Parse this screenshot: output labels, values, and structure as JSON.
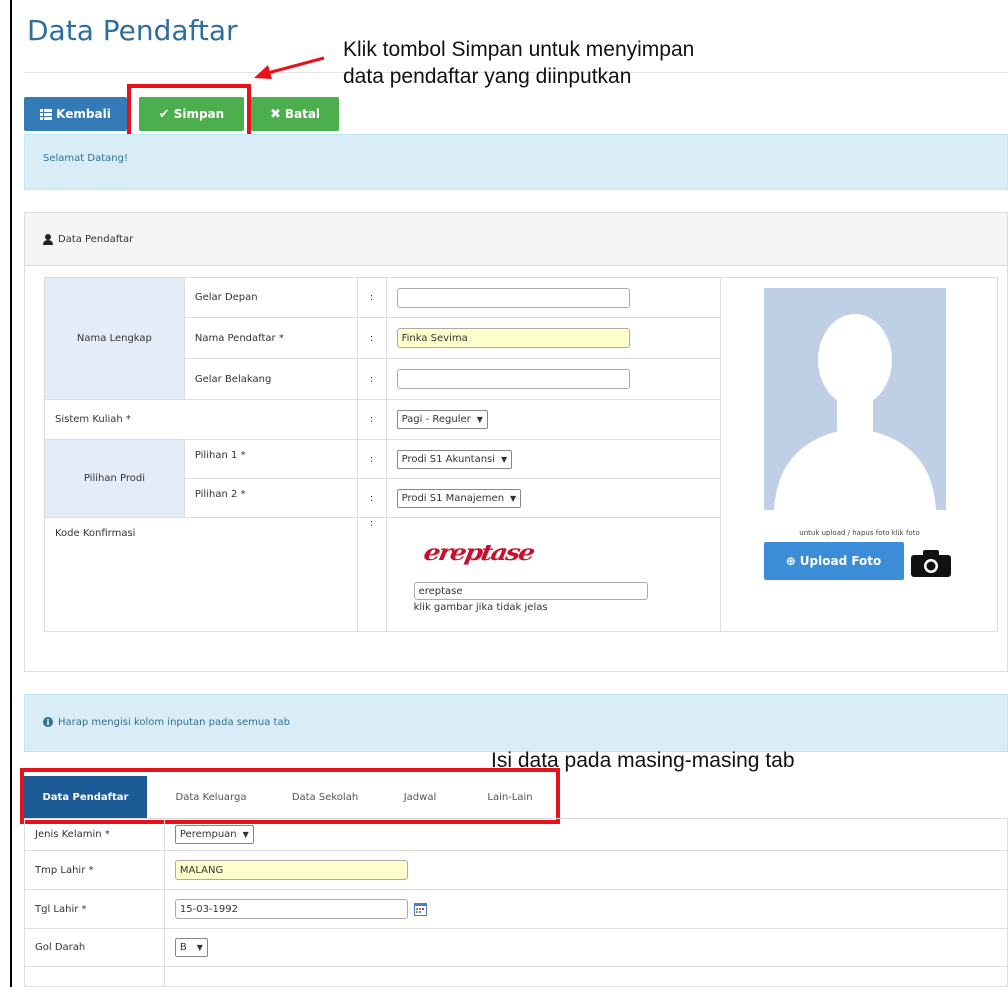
{
  "page": {
    "title": "Data Pendaftar"
  },
  "annotations": {
    "top_line1": "Klik tombol Simpan untuk menyimpan",
    "top_line2": "data pendaftar yang diinputkan",
    "tabs_note": "Isi data pada masing-masing tab"
  },
  "toolbar": {
    "back_label": "Kembali",
    "save_label": "Simpan",
    "cancel_label": "Batal"
  },
  "welcome": "Selamat Datang!",
  "panel": {
    "title": "Data Pendaftar"
  },
  "form": {
    "nama_lengkap_label": "Nama Lengkap",
    "gelar_depan_label": "Gelar Depan",
    "gelar_depan_value": "",
    "nama_pendaftar_label": "Nama Pendaftar *",
    "nama_pendaftar_value": "Finka Sevima",
    "gelar_belakang_label": "Gelar Belakang",
    "gelar_belakang_value": "",
    "sistem_kuliah_label": "Sistem Kuliah *",
    "sistem_kuliah_value": "Pagi - Reguler",
    "pilihan_prodi_label": "Pilihan Prodi",
    "pilihan1_label": "Pilihan 1 *",
    "pilihan1_value": "Prodi S1 Akuntansi",
    "pilihan2_label": "Pilihan 2 *",
    "pilihan2_value": "Prodi S1 Manajemen",
    "kode_label": "Kode Konfirmasi",
    "captcha_text": "ereptase",
    "captcha_input_value": "ereptase",
    "captcha_hint": "klik gambar jika tidak jelas",
    "colon": ":"
  },
  "photo": {
    "hint": "untuk upload / hapus foto klik foto",
    "upload_label": "Upload Foto"
  },
  "notice": "Harap mengisi kolom inputan pada semua tab",
  "tabs": [
    "Data Pendaftar",
    "Data Keluarga",
    "Data Sekolah",
    "Jadwal",
    "Lain-Lain"
  ],
  "bottom_form": {
    "jenis_kelamin_label": "Jenis Kelamin *",
    "jenis_kelamin_value": "Perempuan",
    "tmp_lahir_label": "Tmp Lahir *",
    "tmp_lahir_value": "MALANG",
    "tgl_lahir_label": "Tgl Lahir *",
    "tgl_lahir_value": "15-03-1992",
    "gol_darah_label": "Gol Darah",
    "gol_darah_value": "B"
  },
  "colors": {
    "primary": "#337ab7",
    "success": "#4cae4c",
    "highlight": "#e8101b",
    "tab_active": "#1d5b96"
  }
}
